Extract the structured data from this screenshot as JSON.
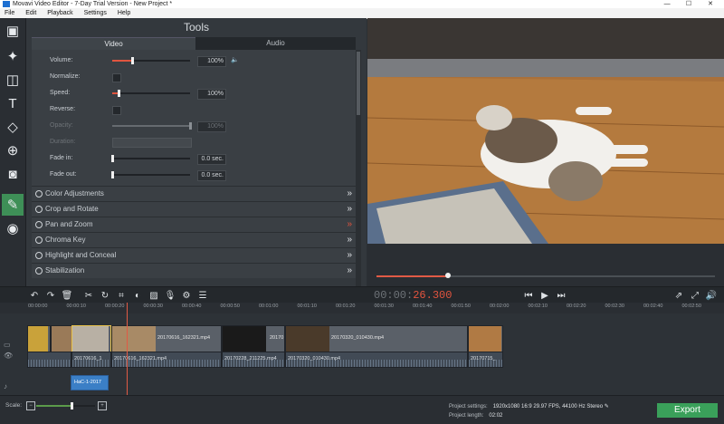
{
  "window": {
    "title": "Movavi Video Editor - 7-Day Trial Version - New Project *",
    "minimize": "—",
    "maximize": "☐",
    "close": "✕"
  },
  "menu": [
    "File",
    "Edit",
    "Playback",
    "Settings",
    "Help"
  ],
  "tools": {
    "title": "Tools",
    "tabs": {
      "video": "Video",
      "audio": "Audio"
    },
    "rows": [
      {
        "label": "Volume:",
        "value": "100%",
        "fraction": 0.25,
        "type": "slider"
      },
      {
        "label": "Normalize:",
        "type": "checkbox"
      },
      {
        "label": "Speed:",
        "value": "100%",
        "fraction": 0.08,
        "type": "slider"
      },
      {
        "label": "Reverse:",
        "type": "checkbox"
      },
      {
        "label": "Opacity:",
        "value": "100%",
        "fraction": 1.0,
        "type": "slider",
        "disabled": true
      },
      {
        "label": "Duration:",
        "type": "duration",
        "disabled": true
      },
      {
        "label": "Fade in:",
        "value": "0.0 sec.",
        "fraction": 0.0,
        "type": "slider"
      },
      {
        "label": "Fade out:",
        "value": "0.0 sec.",
        "fraction": 0.0,
        "type": "slider"
      }
    ],
    "sections": [
      "Color Adjustments",
      "Crop and Rotate",
      "Pan and Zoom",
      "Chroma Key",
      "Highlight and Conceal",
      "Stabilization"
    ]
  },
  "player": {
    "timecode_dim": "00:00:",
    "timecode_active": "26.300",
    "progress": 0.21
  },
  "ruler": [
    "00:00:00",
    "00:00:10",
    "00:00:20",
    "00:00:30",
    "00:00:40",
    "00:00:50",
    "00:01:00",
    "00:01:10",
    "00:01:20",
    "00:01:30",
    "00:01:40",
    "00:01:50",
    "00:02:00",
    "00:02:10",
    "00:02:20",
    "00:02:30",
    "00:02:40",
    "00:02:50"
  ],
  "clips": {
    "video": [
      "20170616_162321.mp4",
      "20170",
      "20170320_010430.mp4"
    ],
    "audio": [
      "20170616_1",
      "20170616_162321.mp4",
      "20170228_211225.mp4",
      "20170320_010430.mp4",
      "20170715_"
    ],
    "overlay": "HaC-1-2017"
  },
  "status": {
    "scale_label": "Scale:",
    "scale": 0.6,
    "project_settings_label": "Project settings:",
    "project_settings_value": "1920x1080 16:9 29.97 FPS, 44100 Hz Stereo",
    "project_length_label": "Project length:",
    "project_length_value": "02:02",
    "export_label": "Export"
  },
  "colors": {
    "accent": "#e2543e",
    "export": "#3aa05a"
  }
}
